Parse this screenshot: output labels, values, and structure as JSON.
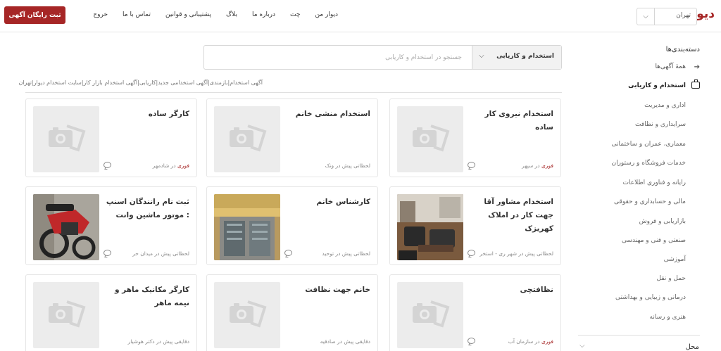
{
  "header": {
    "logo": "دیوار",
    "city": "تهران",
    "nav": [
      "دیوار من",
      "چت",
      "درباره ما",
      "بلاگ",
      "پشتیبانی و قوانین",
      "تماس با ما",
      "خروج"
    ],
    "post_button": "ثبت رایگان آگهی"
  },
  "sidebar": {
    "title": "دسته‌بندی‌ها",
    "all_ads": "همهٔ آگهی‌ها",
    "current_category": "استخدام و کاریابی",
    "subcategories": [
      "اداری و مدیریت",
      "سرایداری و نظافت",
      "معماری، عمران و ساختمانی",
      "خدمات فروشگاه و رستوران",
      "رایانه و فناوری اطلاعات",
      "مالی و حسابداری و حقوقی",
      "بازاریابی و فروش",
      "صنعتی و فنی و مهندسی",
      "آموزشی",
      "حمل و نقل",
      "درمانی و زیبایی و بهداشتی",
      "هنری و رسانه"
    ],
    "region_label": "محل"
  },
  "search": {
    "category": "استخدام و کاریابی",
    "placeholder": "جستجو در استخدام و کاریابی"
  },
  "breadcrumb": "آگهی استخدام|بازمندی|آگهی استخدامی جدید|کاریابی|آگهی استخدام بازار کار|سایت استخدام دیوار|تهران",
  "cards": [
    {
      "title": "استخدام نیروی کار ساده",
      "urgent": "فوری",
      "meta": "در سپهر"
    },
    {
      "title": "استخدام منشی خانم",
      "urgent": "",
      "meta": "لحظاتی پیش در ونک"
    },
    {
      "title": "کارگر ساده",
      "urgent": "فوری",
      "meta": "در شادمهر"
    },
    {
      "title": "استخدام مشاور آقا جهت کار در املاک کهریزک",
      "urgent": "",
      "meta": "لحظاتی پیش در شهر ری - استخر"
    },
    {
      "title": "کارشناس خانم",
      "urgent": "",
      "meta": "لحظاتی پیش در توحید"
    },
    {
      "title": "ثبت نام رانندگان اسنپ : موتور ماشین وانت",
      "urgent": "",
      "meta": "لحظاتی پیش در میدان حر"
    },
    {
      "title": "نظافتچی",
      "urgent": "فوری",
      "meta": "در سازمان آب"
    },
    {
      "title": "خانم جهت نظافت",
      "urgent": "",
      "meta": "دقایقی پیش در صادقیه"
    },
    {
      "title": "کارگر مکانیک ماهر و نیمه ماهر",
      "urgent": "",
      "meta": "دقایقی پیش در دکتر هوشیار"
    }
  ],
  "colors": {
    "brand": "#a62626",
    "urgent": "#a62626"
  }
}
